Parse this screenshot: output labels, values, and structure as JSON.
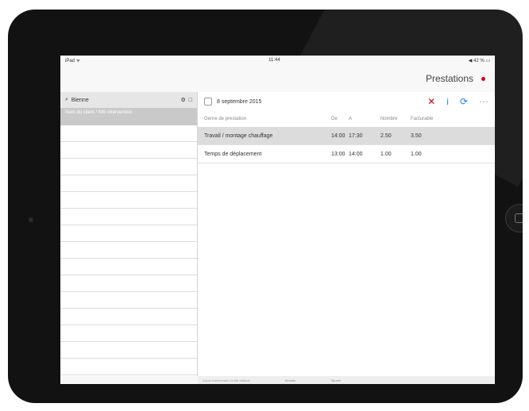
{
  "status": {
    "left": "iPad ᯤ",
    "time": "11:44",
    "right": "◀ 42 % ▭"
  },
  "nav": {
    "title": "Prestations"
  },
  "sidebar": {
    "search_value": "Bienne",
    "selected_label": "Nom du client / Info intervention"
  },
  "toolbar": {
    "date": "8 septembre 2015",
    "delete": "✕",
    "info": "i",
    "refresh": "⟳",
    "more": "⋯"
  },
  "table": {
    "headers": [
      "Genre de prestation",
      "De",
      "A",
      "Nombre",
      "Facturable"
    ],
    "rows": [
      {
        "name": "Travail / montage chauffage",
        "from": "14:00",
        "to": "17:30",
        "qty": "2.50",
        "bill": "3.50"
      },
      {
        "name": "Temps de déplacement",
        "from": "13:00",
        "to": "14:00",
        "qty": "1.00",
        "bill": "1.00"
      }
    ]
  },
  "footer": {
    "note": "Aucun intervenant n'a été attribué",
    "btn1": "Annuler",
    "btn2": "Sauver"
  }
}
